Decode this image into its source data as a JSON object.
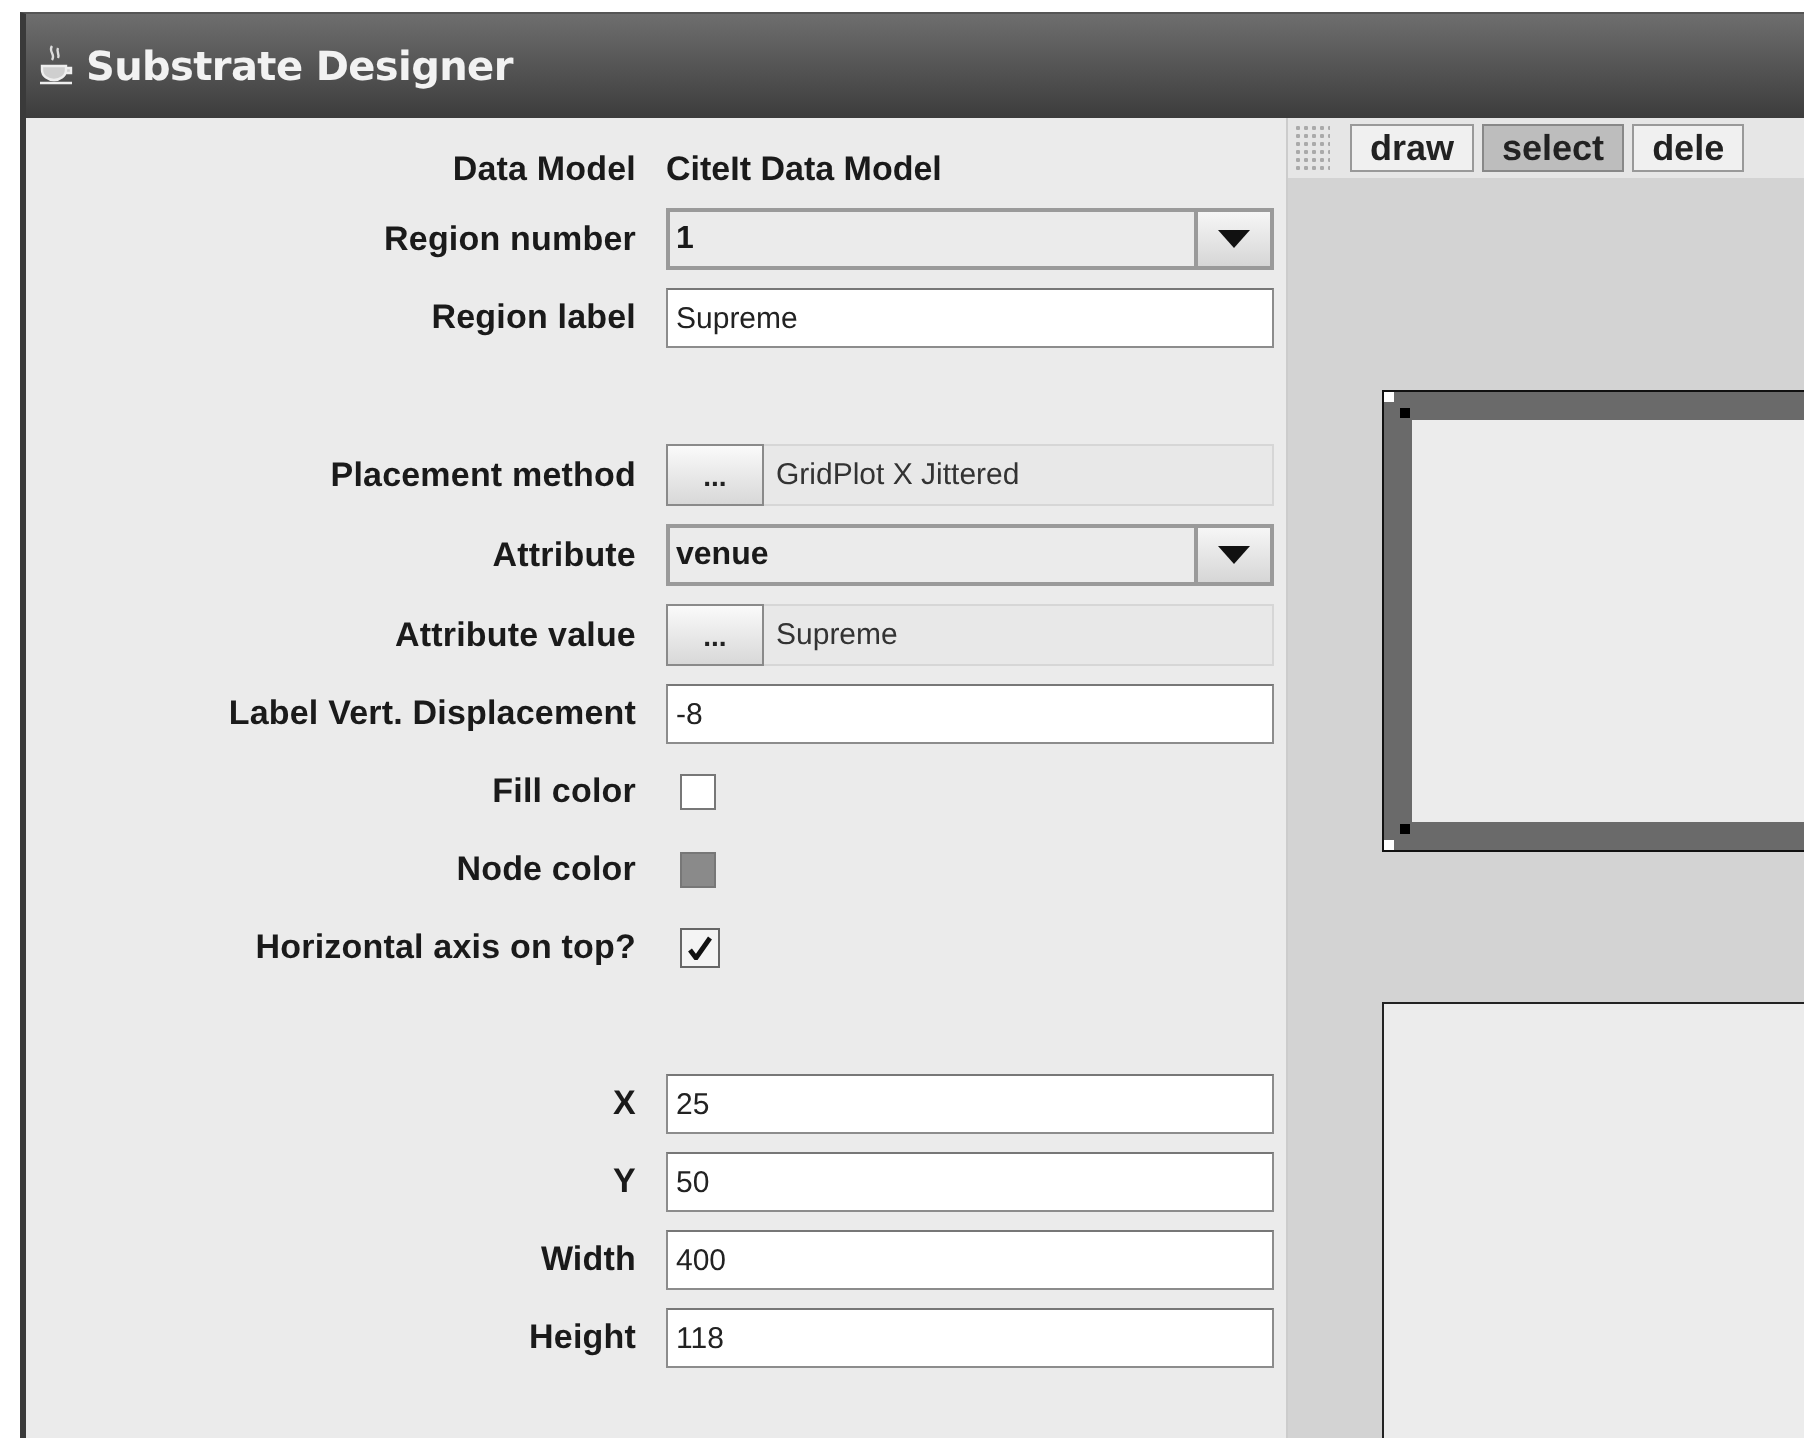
{
  "window": {
    "title": "Substrate Designer"
  },
  "form": {
    "sections": [
      [
        {
          "kind": "static",
          "label": "Data Model",
          "value": "CiteIt Data Model"
        },
        {
          "kind": "combo",
          "label": "Region number",
          "value": "1"
        },
        {
          "kind": "text",
          "label": "Region label",
          "value": "Supreme"
        }
      ],
      [
        {
          "kind": "chooser",
          "label": "Placement method",
          "button": "...",
          "value": "GridPlot X Jittered"
        },
        {
          "kind": "combo",
          "label": "Attribute",
          "value": "venue"
        },
        {
          "kind": "chooser",
          "label": "Attribute value",
          "button": "...",
          "value": "Supreme"
        },
        {
          "kind": "text",
          "label": "Label Vert. Displacement",
          "value": "-8"
        },
        {
          "kind": "color",
          "label": "Fill color",
          "color": "#ffffff"
        },
        {
          "kind": "color",
          "label": "Node color",
          "color": "#8a8a8a"
        },
        {
          "kind": "checkbox",
          "label": "Horizontal axis on top?",
          "checked": true
        }
      ],
      [
        {
          "kind": "text",
          "label": "X",
          "value": "25"
        },
        {
          "kind": "text",
          "label": "Y",
          "value": "50"
        },
        {
          "kind": "text",
          "label": "Width",
          "value": "400"
        },
        {
          "kind": "text",
          "label": "Height",
          "value": "118"
        }
      ]
    ]
  },
  "toolbar": {
    "buttons": [
      {
        "label": "draw",
        "selected": false
      },
      {
        "label": "select",
        "selected": true
      },
      {
        "label": "dele",
        "selected": false
      }
    ]
  },
  "canvas": {
    "regions": [
      {
        "selected": true
      },
      {
        "selected": false
      }
    ]
  }
}
